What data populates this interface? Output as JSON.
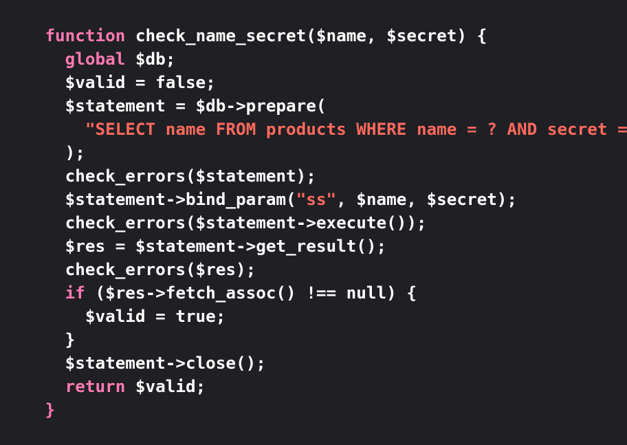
{
  "theme": {
    "background": "#1f1f24",
    "plain": "#ffffff",
    "keyword": "#ff7ab2",
    "string": "#fc6a5d"
  },
  "code": {
    "lines": [
      [
        {
          "t": "kw",
          "v": "function"
        },
        {
          "t": "plain",
          "v": " check_name_secret($name, $secret) {"
        }
      ],
      [
        {
          "t": "plain",
          "v": "  "
        },
        {
          "t": "kw",
          "v": "global"
        },
        {
          "t": "plain",
          "v": " $db;"
        }
      ],
      [
        {
          "t": "plain",
          "v": "  $valid = false;"
        }
      ],
      [
        {
          "t": "plain",
          "v": "  $statement = $db->prepare("
        }
      ],
      [
        {
          "t": "plain",
          "v": "    "
        },
        {
          "t": "str",
          "v": "\"SELECT name FROM products WHERE name = ? AND secret = ?\""
        }
      ],
      [
        {
          "t": "plain",
          "v": "  );"
        }
      ],
      [
        {
          "t": "plain",
          "v": "  check_errors($statement);"
        }
      ],
      [
        {
          "t": "plain",
          "v": "  $statement->bind_param("
        },
        {
          "t": "str",
          "v": "\"ss\""
        },
        {
          "t": "plain",
          "v": ", $name, $secret);"
        }
      ],
      [
        {
          "t": "plain",
          "v": "  check_errors($statement->execute());"
        }
      ],
      [
        {
          "t": "plain",
          "v": "  $res = $statement->get_result();"
        }
      ],
      [
        {
          "t": "plain",
          "v": "  check_errors($res);"
        }
      ],
      [
        {
          "t": "plain",
          "v": "  "
        },
        {
          "t": "kw",
          "v": "if"
        },
        {
          "t": "plain",
          "v": " ($res->fetch_assoc() !== null) {"
        }
      ],
      [
        {
          "t": "plain",
          "v": "    $valid = true;"
        }
      ],
      [
        {
          "t": "plain",
          "v": "  }"
        }
      ],
      [
        {
          "t": "plain",
          "v": "  $statement->close();"
        }
      ],
      [
        {
          "t": "plain",
          "v": "  "
        },
        {
          "t": "kw",
          "v": "return"
        },
        {
          "t": "plain",
          "v": " $valid;"
        }
      ],
      [
        {
          "t": "kw",
          "v": "}"
        }
      ]
    ]
  }
}
